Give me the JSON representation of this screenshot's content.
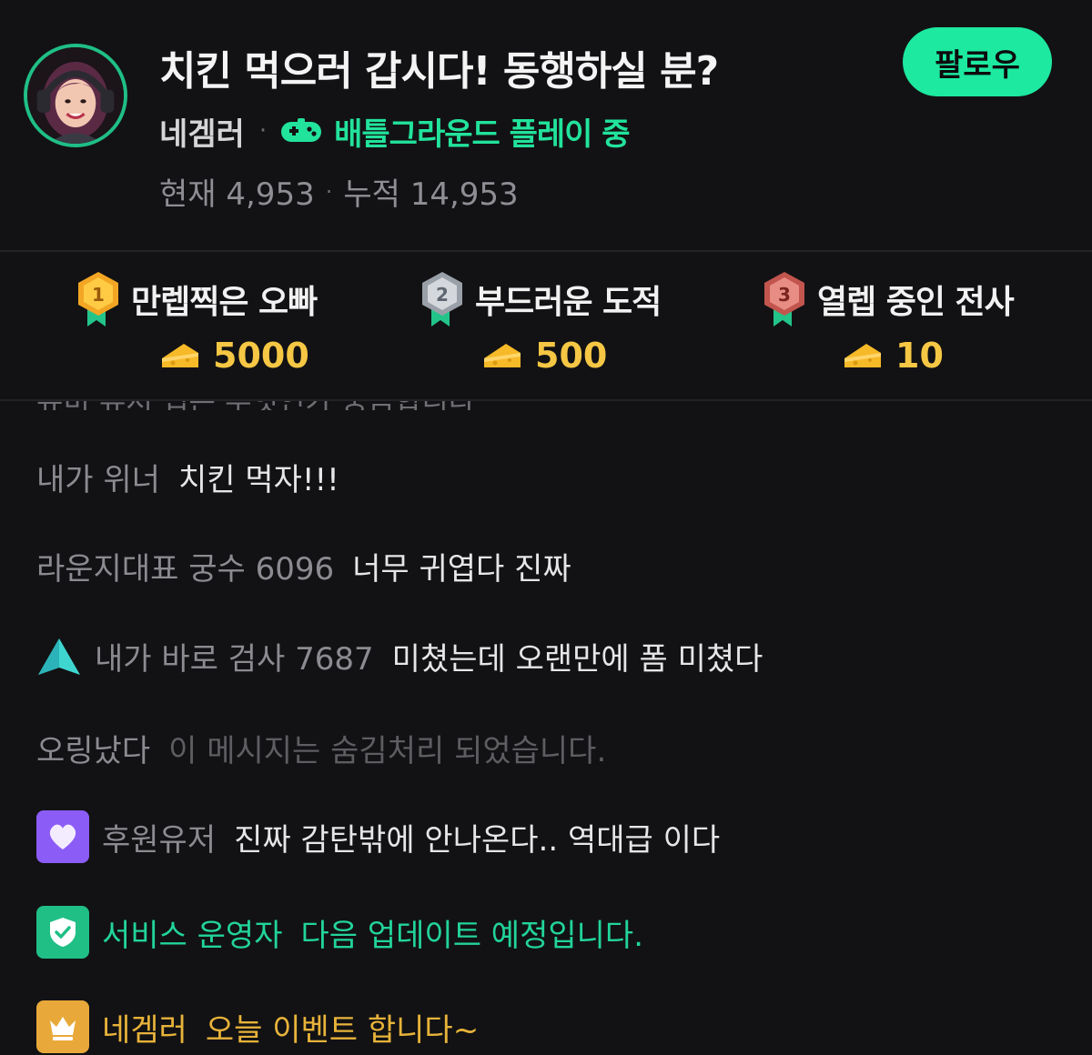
{
  "header": {
    "title": "치킨 먹으러 갑시다! 동행하실 분?",
    "streamer_name": "네겜러",
    "separator": "·",
    "game_label": "배틀그라운드 플레이 중",
    "follow_label": "팔로우",
    "stats": {
      "current": "현재 4,953",
      "separator": "·",
      "total": "누적 14,953"
    }
  },
  "ranking": [
    {
      "rank": "1",
      "name": "만렙찍은 오빠",
      "amount": "5000"
    },
    {
      "rank": "2",
      "name": "부드러운 도적",
      "amount": "500"
    },
    {
      "rank": "3",
      "name": "열렙 중인 전사",
      "amount": "10"
    }
  ],
  "chat": {
    "partial_line": "뉴비 유저 팁은 무엇인가 궁금합니다",
    "messages": [
      {
        "nick": "내가 위너",
        "text": "치킨 먹자!!!"
      },
      {
        "nick": "라운지대표 궁수 6096",
        "text": "너무 귀엽다 진짜"
      },
      {
        "nick": "내가 바로 검사 7687",
        "text": "미쳤는데 오랜만에 폼 미쳤다",
        "badge": "triangle-icon"
      },
      {
        "nick": "오링났다",
        "text": "이 메시지는 숨김처리 되었습니다."
      },
      {
        "nick": "후원유저",
        "text": "진짜 감탄밖에 안나온다.. 역대급 이다",
        "badge": "heart-icon"
      },
      {
        "nick": "서비스 운영자",
        "text": "다음 업데이트 예정입니다.",
        "badge": "shield-check-icon"
      },
      {
        "nick": "네겜러",
        "text": "오늘 이벤트 합니다~",
        "badge": "crown-icon"
      }
    ]
  },
  "colors": {
    "accent": "#1de9a0",
    "game": "#22e39c",
    "donation": "#f6c744",
    "supporter_badge": "#8b5cf6",
    "operator_badge": "#1fbf86",
    "streamer_badge": "#e8a93a"
  }
}
